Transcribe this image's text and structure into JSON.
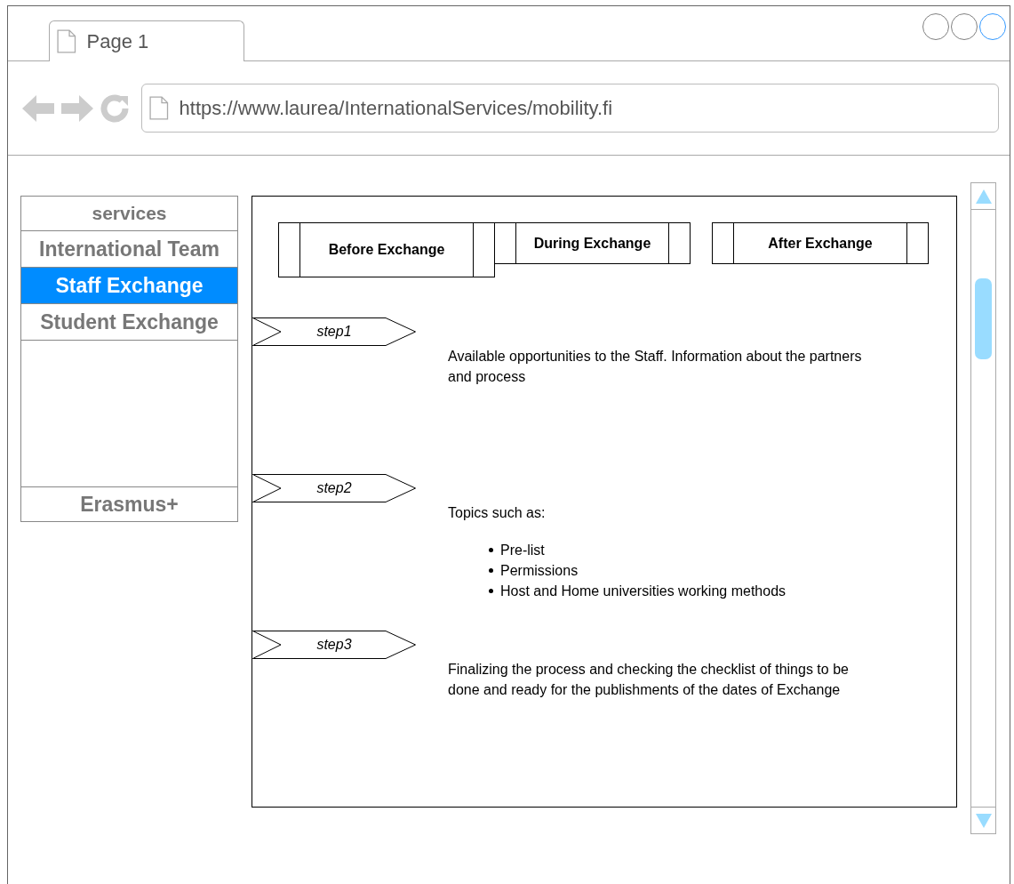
{
  "window": {
    "tab": "Page 1",
    "url": "https://www.laurea/InternationalServices/mobility.fi",
    "window_buttons": [
      {
        "color": "#808080"
      },
      {
        "color": "#808080"
      },
      {
        "color": "#3399ff"
      }
    ]
  },
  "sidebar": {
    "items": [
      {
        "label": "services",
        "kind": "header",
        "selected": false
      },
      {
        "label": "International Team",
        "kind": "item",
        "selected": false
      },
      {
        "label": "Staff Exchange",
        "kind": "item",
        "selected": true
      },
      {
        "label": "Student Exchange",
        "kind": "item",
        "selected": false
      },
      {
        "label": "Erasmus+",
        "kind": "footer",
        "selected": false
      }
    ]
  },
  "tabs": [
    {
      "label": "Before Exchange",
      "selected": true
    },
    {
      "label": "During Exchange",
      "selected": false
    },
    {
      "label": "After Exchange",
      "selected": false
    }
  ],
  "steps": [
    {
      "label": "step1",
      "text": "Available opportunities to the Staff. Information about the partners and process"
    },
    {
      "label": "step2",
      "text": "Topics such as:",
      "bullets": [
        "Pre-list",
        "Permissions",
        "Host and Home universities working methods"
      ]
    },
    {
      "label": "step3",
      "text": "Finalizing the process and checking the checklist of things to be done and ready for the publishments of the dates of Exchange"
    }
  ]
}
